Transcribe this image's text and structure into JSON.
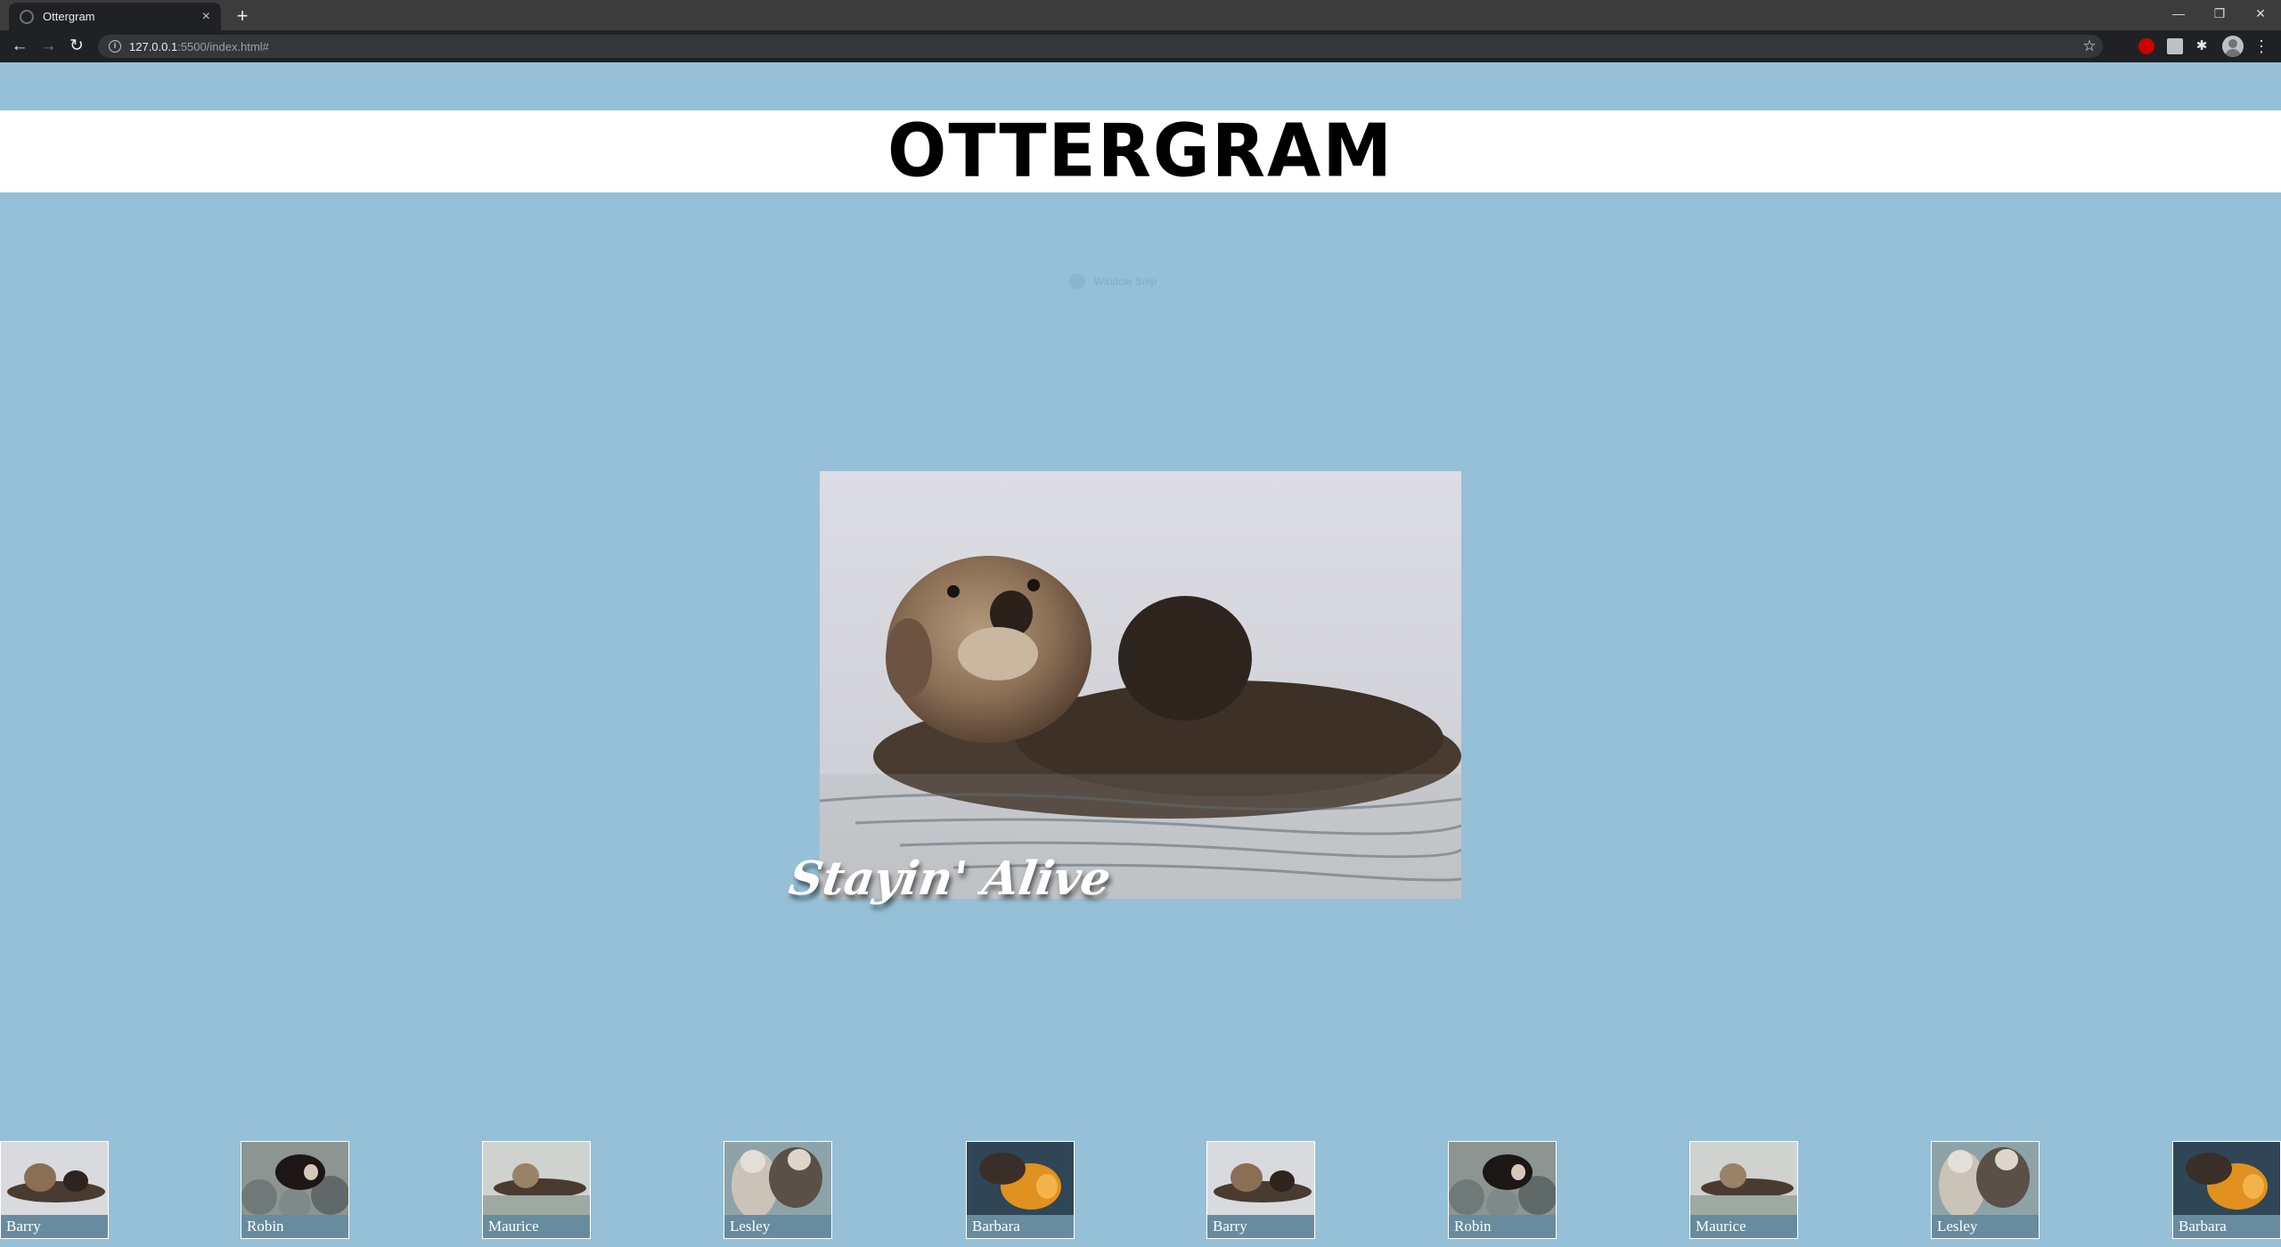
{
  "browser": {
    "tab_title": "Ottergram",
    "url_host": "127.0.0.1",
    "url_path": ":5500/index.html#",
    "new_tab": "+",
    "tab_close": "×",
    "back": "←",
    "forward": "→",
    "reload": "↻",
    "star": "☆",
    "menu": "⋮",
    "minimize": "—",
    "restore": "❐",
    "close": "✕",
    "info_glyph": "i"
  },
  "header": {
    "title": "OTTERGRAM"
  },
  "ghost_text": "Window Snip",
  "detail": {
    "title": "Stayin' Alive"
  },
  "thumbnails": [
    {
      "label": "Barry",
      "icon": "otter-floating"
    },
    {
      "label": "Robin",
      "icon": "otter-on-rocks"
    },
    {
      "label": "Maurice",
      "icon": "otter-floating"
    },
    {
      "label": "Lesley",
      "icon": "otters-pair"
    },
    {
      "label": "Barbara",
      "icon": "otter-orange"
    },
    {
      "label": "Barry",
      "icon": "otter-floating"
    },
    {
      "label": "Robin",
      "icon": "otter-on-rocks"
    },
    {
      "label": "Maurice",
      "icon": "otter-floating"
    },
    {
      "label": "Lesley",
      "icon": "otters-pair"
    },
    {
      "label": "Barbara",
      "icon": "otter-orange"
    }
  ],
  "colors": {
    "page_bg": "#95c0d7",
    "header_bg": "#ffffff",
    "thumb_label_bg": "#678c9f",
    "chrome_dark": "#202124"
  }
}
